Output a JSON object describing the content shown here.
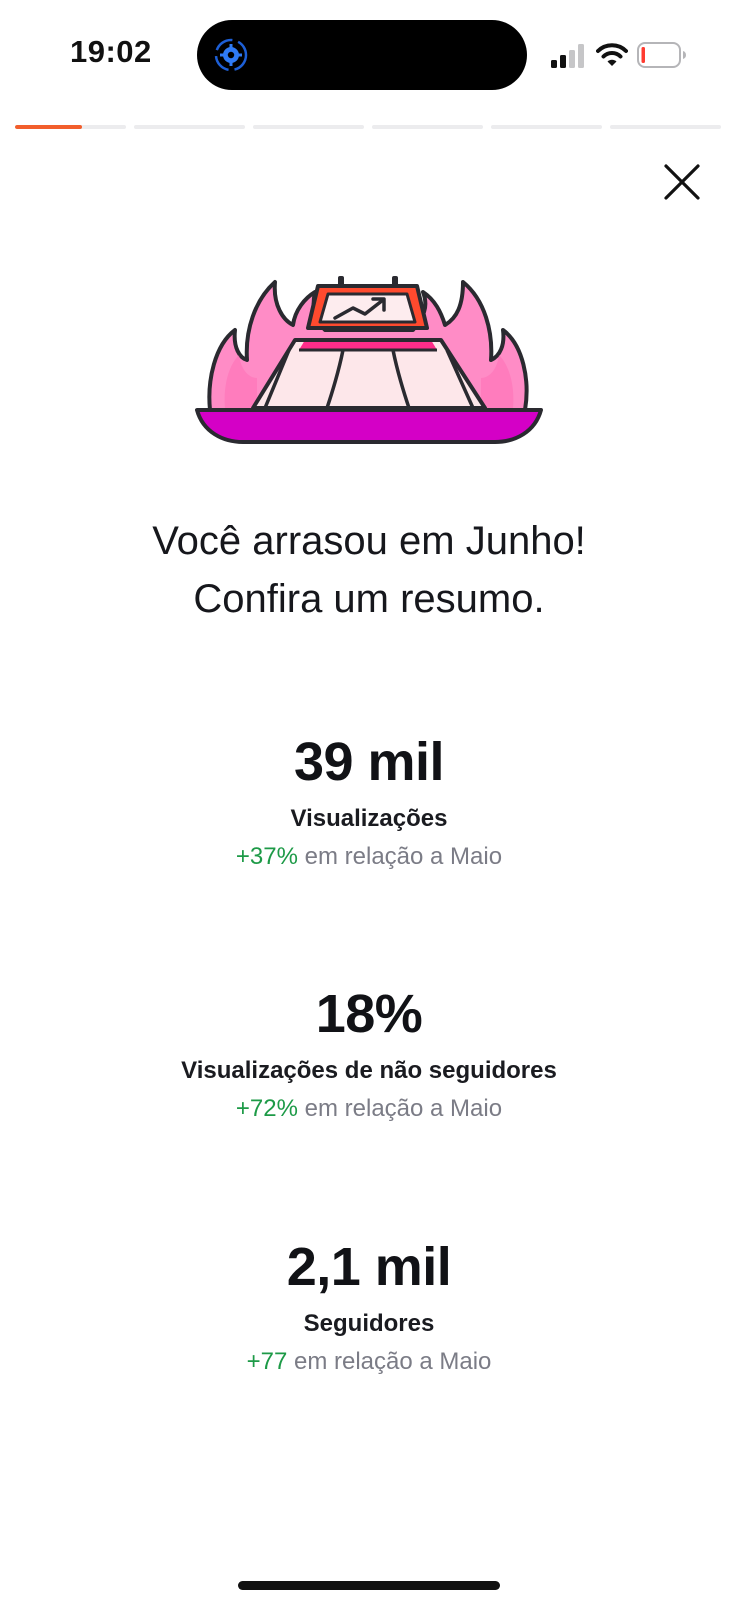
{
  "status_bar": {
    "time": "19:02",
    "signal_icon": "cellular-signal-icon",
    "wifi_icon": "wifi-icon",
    "battery_icon": "battery-low-icon",
    "island_icon": "sync-gear-icon"
  },
  "story": {
    "segments": 6,
    "current_segment": 1,
    "current_progress": 0.6,
    "accent_color": "#f25e2c"
  },
  "close_icon": "close-icon",
  "illustration_icon": "fire-trending-chart-icon",
  "headline": {
    "line1": "Você arrasou em Junho!",
    "line2": "Confira um resumo."
  },
  "stats": [
    {
      "value": "39 mil",
      "label": "Visualizações",
      "delta": "+37%",
      "comparison": "em relação a Maio"
    },
    {
      "value": "18%",
      "label": "Visualizações de não seguidores",
      "delta": "+72%",
      "comparison": "em relação a Maio"
    },
    {
      "value": "2,1 mil",
      "label": "Seguidores",
      "delta": "+77",
      "comparison": "em relação a Maio"
    }
  ],
  "colors": {
    "positive": "#1d9a47",
    "muted": "#7b7c86",
    "flame_pink": "#ff8cc6",
    "tray_magenta": "#d400c6"
  }
}
